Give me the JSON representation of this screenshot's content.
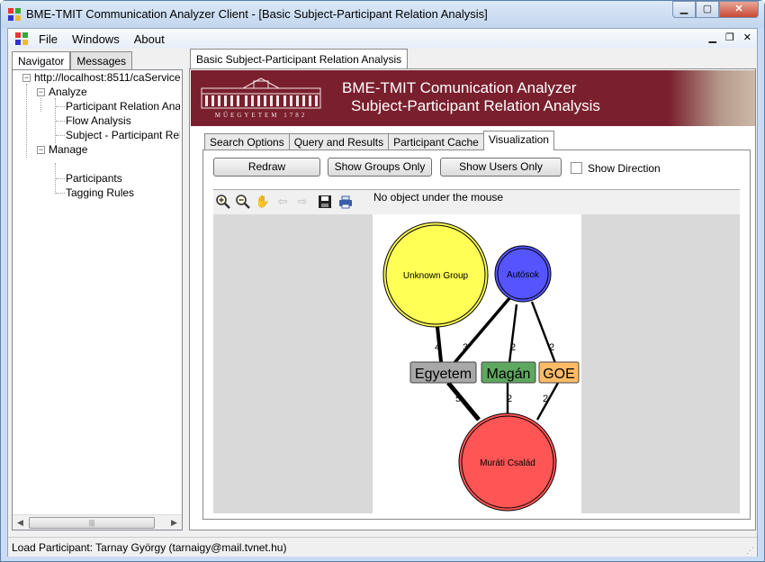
{
  "window": {
    "title": "BME-TMIT Communication Analyzer Client - [Basic Subject-Participant Relation Analysis]"
  },
  "menu": {
    "file": "File",
    "windows": "Windows",
    "about": "About"
  },
  "left_tabs": {
    "navigator": "Navigator",
    "messages": "Messages"
  },
  "tree": {
    "root": "http://localhost:8511/caService -",
    "analyze": "Analyze",
    "analyze_items": [
      "Participant Relation Analys",
      "Flow Analysis",
      "Subject - Participant Relat"
    ],
    "manage": "Manage",
    "manage_items": [
      "Participants",
      "Tagging Rules"
    ]
  },
  "document_tab": "Basic Subject-Participant Relation Analysis",
  "banner": {
    "logo_text": "MŰEGYETEM 1782",
    "line1": "BME-TMIT Comunication Analyzer",
    "line2": "Subject-Participant Relation Analysis"
  },
  "inner_tabs": [
    "Search Options",
    "Query and Results",
    "Participant  Cache",
    "Visualization"
  ],
  "buttons": {
    "redraw": "Redraw",
    "show_groups": "Show Groups Only",
    "show_users": "Show Users Only"
  },
  "show_direction": {
    "label": "Show Direction",
    "checked": false
  },
  "viewer": {
    "hover_status": "No object under the mouse",
    "toolbar_icons": [
      "zoom-in-icon",
      "zoom-out-icon",
      "pan-hand-icon",
      "back-arrow-icon",
      "forward-arrow-icon",
      "save-icon",
      "print-icon"
    ]
  },
  "graph": {
    "nodes": {
      "unknown_group": {
        "label": "Unknown Group",
        "color": "#ffff55"
      },
      "autosok": {
        "label": "Autósok",
        "color": "#5555ff"
      },
      "murati": {
        "label": "Muráti Család",
        "color": "#ff5555"
      },
      "egyetem": {
        "label": "Egyetem",
        "color": "#a8a8a8"
      },
      "magan": {
        "label": "Magán",
        "color": "#5fa85f"
      },
      "goe": {
        "label": "GOE",
        "color": "#ffbb66"
      }
    },
    "edges": [
      {
        "from": "unknown_group",
        "to": "egyetem",
        "weight": "4"
      },
      {
        "from": "autosok",
        "to": "egyetem",
        "weight": "3"
      },
      {
        "from": "autosok",
        "to": "magan",
        "weight": "2"
      },
      {
        "from": "autosok",
        "to": "goe",
        "weight": "2"
      },
      {
        "from": "egyetem",
        "to": "murati",
        "weight": "5"
      },
      {
        "from": "magan",
        "to": "murati",
        "weight": "2"
      },
      {
        "from": "goe",
        "to": "murati",
        "weight": "2"
      }
    ]
  },
  "status_bar": "Load Participant: Tarnay György (tarnaigy@mail.tvnet.hu)"
}
